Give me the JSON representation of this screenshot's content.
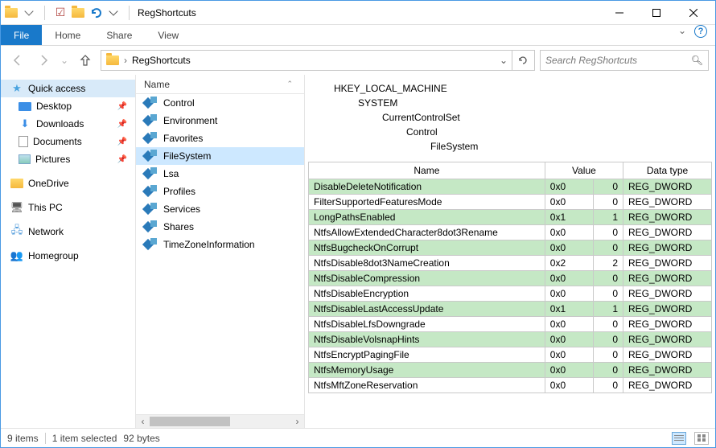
{
  "title": "RegShortcuts",
  "ribbon": {
    "file": "File",
    "home": "Home",
    "share": "Share",
    "view": "View"
  },
  "address": {
    "crumb": "RegShortcuts"
  },
  "search": {
    "placeholder": "Search RegShortcuts"
  },
  "nav": {
    "quick_access": "Quick access",
    "desktop": "Desktop",
    "downloads": "Downloads",
    "documents": "Documents",
    "pictures": "Pictures",
    "onedrive": "OneDrive",
    "this_pc": "This PC",
    "network": "Network",
    "homegroup": "Homegroup"
  },
  "filelist": {
    "header": "Name",
    "items": [
      "Control",
      "Environment",
      "Favorites",
      "FileSystem",
      "Lsa",
      "Profiles",
      "Services",
      "Shares",
      "TimeZoneInformation"
    ]
  },
  "regpath": [
    "HKEY_LOCAL_MACHINE",
    "SYSTEM",
    "CurrentControlSet",
    "Control",
    "FileSystem"
  ],
  "regtable": {
    "cols": {
      "name": "Name",
      "value": "Value",
      "dt": "Data type"
    },
    "rows": [
      {
        "n": "DisableDeleteNotification",
        "h": "0x0",
        "d": "0",
        "t": "REG_DWORD",
        "g": true
      },
      {
        "n": "FilterSupportedFeaturesMode",
        "h": "0x0",
        "d": "0",
        "t": "REG_DWORD",
        "g": false
      },
      {
        "n": "LongPathsEnabled",
        "h": "0x1",
        "d": "1",
        "t": "REG_DWORD",
        "g": true
      },
      {
        "n": "NtfsAllowExtendedCharacter8dot3Rename",
        "h": "0x0",
        "d": "0",
        "t": "REG_DWORD",
        "g": false
      },
      {
        "n": "NtfsBugcheckOnCorrupt",
        "h": "0x0",
        "d": "0",
        "t": "REG_DWORD",
        "g": true
      },
      {
        "n": "NtfsDisable8dot3NameCreation",
        "h": "0x2",
        "d": "2",
        "t": "REG_DWORD",
        "g": false
      },
      {
        "n": "NtfsDisableCompression",
        "h": "0x0",
        "d": "0",
        "t": "REG_DWORD",
        "g": true
      },
      {
        "n": "NtfsDisableEncryption",
        "h": "0x0",
        "d": "0",
        "t": "REG_DWORD",
        "g": false
      },
      {
        "n": "NtfsDisableLastAccessUpdate",
        "h": "0x1",
        "d": "1",
        "t": "REG_DWORD",
        "g": true
      },
      {
        "n": "NtfsDisableLfsDowngrade",
        "h": "0x0",
        "d": "0",
        "t": "REG_DWORD",
        "g": false
      },
      {
        "n": "NtfsDisableVolsnapHints",
        "h": "0x0",
        "d": "0",
        "t": "REG_DWORD",
        "g": true
      },
      {
        "n": "NtfsEncryptPagingFile",
        "h": "0x0",
        "d": "0",
        "t": "REG_DWORD",
        "g": false
      },
      {
        "n": "NtfsMemoryUsage",
        "h": "0x0",
        "d": "0",
        "t": "REG_DWORD",
        "g": true
      },
      {
        "n": "NtfsMftZoneReservation",
        "h": "0x0",
        "d": "0",
        "t": "REG_DWORD",
        "g": false
      }
    ]
  },
  "status": {
    "items": "9 items",
    "selected": "1 item selected",
    "size": "92 bytes"
  }
}
